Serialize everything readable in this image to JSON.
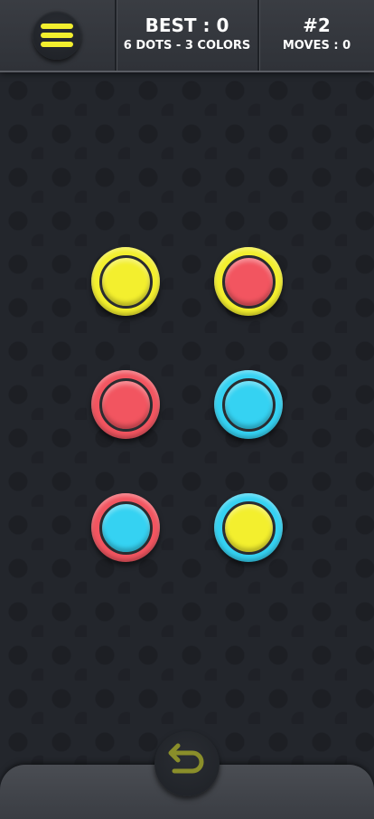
{
  "header": {
    "best": "BEST : 0",
    "info": "6 DOTS - 3 COLORS",
    "level": "#2",
    "moves": "MOVES : 0"
  },
  "icons": {
    "menu": "hamburger-menu-icon",
    "undo": "undo-arrow-icon"
  },
  "colors": {
    "yellow": "#f3ef2e",
    "red": "#f25560",
    "blue": "#35d2f2",
    "menu_accent": "#f3ef2e",
    "undo_accent": "#8a8e2a"
  },
  "board": {
    "dots": [
      {
        "outer": "yellow",
        "inner": "yellow"
      },
      {
        "outer": "yellow",
        "inner": "red"
      },
      {
        "outer": "red",
        "inner": "red"
      },
      {
        "outer": "blue",
        "inner": "blue"
      },
      {
        "outer": "red",
        "inner": "blue"
      },
      {
        "outer": "blue",
        "inner": "yellow"
      }
    ]
  }
}
